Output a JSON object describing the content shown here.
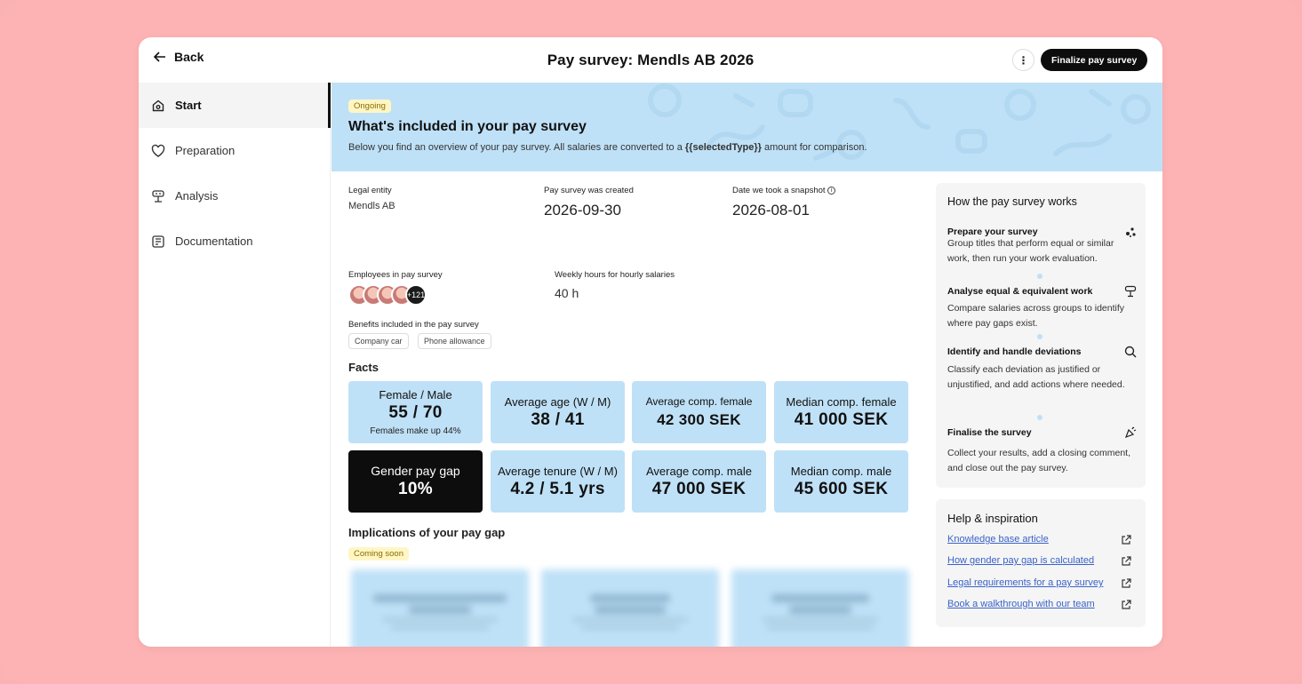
{
  "header": {
    "back_label": "Back",
    "title": "Pay survey: Mendls AB 2026",
    "more_label": "⋮",
    "finalize_label": "Finalize pay survey"
  },
  "sidebar": {
    "items": [
      {
        "label": "Start",
        "icon": "home-icon",
        "active": true
      },
      {
        "label": "Preparation",
        "icon": "heart-icon",
        "active": false
      },
      {
        "label": "Analysis",
        "icon": "scale-icon",
        "active": false
      },
      {
        "label": "Documentation",
        "icon": "document-icon",
        "active": false
      }
    ]
  },
  "banner": {
    "badge": "Ongoing",
    "heading": "What's included in your pay survey",
    "desc_before": "Below you find an overview of your pay survey. All salaries are converted to a ",
    "desc_bold": "{{selectedType}}",
    "desc_after": " amount for comparison."
  },
  "overview": {
    "legal_entity_label": "Legal entity",
    "legal_entity_value": "Mendls AB",
    "created_label": "Pay survey was created",
    "created_value": "2026-09-30",
    "snapshot_label": "Date we took a snapshot",
    "snapshot_value": "2026-08-01",
    "employees_label": "Employees in pay survey",
    "employees_more": "+121",
    "weekly_label": "Weekly hours for hourly salaries",
    "weekly_value": "40 h",
    "benefits_label": "Benefits included in the pay survey",
    "benefits": [
      "Company car",
      "Phone allowance"
    ]
  },
  "facts": {
    "title": "Facts",
    "cards": [
      {
        "label": "Female / Male",
        "value": "55 / 70",
        "sub": "Females make up 44%"
      },
      {
        "label": "Average age (W / M)",
        "value": "38 / 41"
      },
      {
        "label": "Average comp. female",
        "value": "42 300 SEK"
      },
      {
        "label": "Median comp. female",
        "value": "41 000 SEK"
      },
      {
        "label": "Gender pay gap",
        "value": "10%"
      },
      {
        "label": "Average tenure (W / M)",
        "value": "4.2 / 5.1 yrs"
      },
      {
        "label": "Average comp. male",
        "value": "47 000 SEK"
      },
      {
        "label": "Median comp. male",
        "value": "45 600 SEK"
      }
    ]
  },
  "implications": {
    "title": "Implications of your pay gap",
    "badge": "Coming soon"
  },
  "how": {
    "title": "How the pay survey works",
    "steps": [
      {
        "title": "Prepare your survey",
        "desc": "Group titles that perform equal or similar work, then run your work evaluation.",
        "icon": "dots-icon"
      },
      {
        "title": "Analyse equal & equivalent work",
        "desc": "Compare salaries across groups to identify where pay gaps exist.",
        "icon": "scale-icon"
      },
      {
        "title": "Identify and handle deviations",
        "desc": "Classify each deviation as justified or unjustified, and add actions where needed.",
        "icon": "search-icon"
      },
      {
        "title": "Finalise the survey",
        "desc": "Collect your results, add a closing comment, and close out the pay survey.",
        "icon": "party-icon"
      }
    ]
  },
  "help": {
    "title": "Help & inspiration",
    "links": [
      "Knowledge base article",
      "How gender pay gap is calculated",
      "Legal requirements for a pay survey",
      "Book a walkthrough with our team"
    ]
  },
  "colors": {
    "background": "#fdb3b3",
    "card_blue": "#bfe1f7",
    "dark": "#0d0d0d",
    "badge_yellow": "#fff6c4",
    "link": "#3a62c8"
  }
}
